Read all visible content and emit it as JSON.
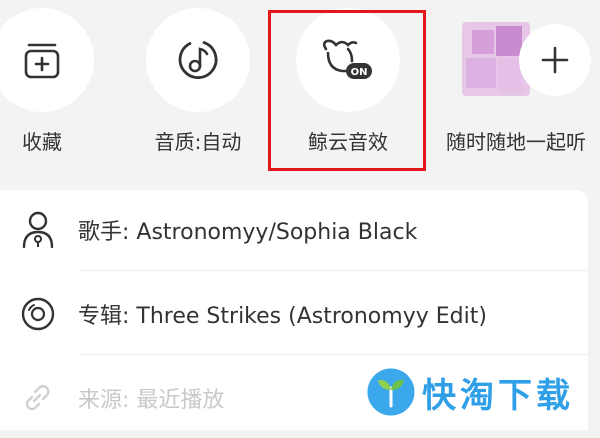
{
  "actions": [
    {
      "id": "collect",
      "label": "收藏",
      "icon": "collect-icon"
    },
    {
      "id": "quality",
      "label": "音质:自动",
      "icon": "music-disc-icon"
    },
    {
      "id": "sound-effect",
      "label": "鲸云音效",
      "icon": "whale-cloud-sound-icon",
      "badge": "ON"
    },
    {
      "id": "listen-together",
      "label": "随时随地一起听",
      "icon": "plus-icon"
    }
  ],
  "info": {
    "singer": {
      "key": "歌手:",
      "value": "Astronomyy/Sophia Black",
      "icon": "person-icon"
    },
    "album": {
      "key": "专辑:",
      "value": "Three Strikes (Astronomyy Edit)",
      "icon": "album-disc-icon"
    },
    "source": {
      "key": "来源:",
      "value": "最近播放",
      "icon": "link-icon"
    }
  },
  "watermark": {
    "text": "快淘下载",
    "icon": "sprout-icon"
  },
  "colors": {
    "highlight": "#e5161b",
    "watermark": "#2fa0e8",
    "background": "#f3f3f4"
  }
}
